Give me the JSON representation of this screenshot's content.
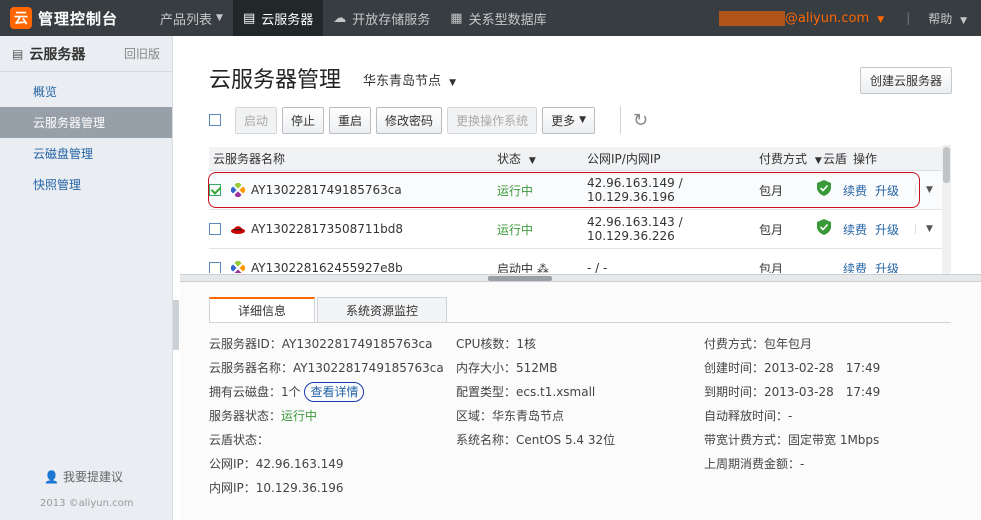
{
  "topbar": {
    "logo_glyph": "云",
    "brand": "管理控制台",
    "nav": [
      {
        "label": "产品列表",
        "icon": "",
        "caret": true,
        "active": false
      },
      {
        "label": "云服务器",
        "icon": "server-icon",
        "caret": false,
        "active": true
      },
      {
        "label": "开放存储服务",
        "icon": "cloud-icon",
        "caret": false,
        "active": false
      },
      {
        "label": "关系型数据库",
        "icon": "database-icon",
        "caret": false,
        "active": false
      }
    ],
    "user_blur": "■■■■■",
    "user_suffix": "@aliyun.com",
    "help": "帮助"
  },
  "sidebar": {
    "title": "云服务器",
    "old_version": "回旧版",
    "items": [
      {
        "label": "概览"
      },
      {
        "label": "云服务器管理"
      },
      {
        "label": "云磁盘管理"
      },
      {
        "label": "快照管理"
      }
    ],
    "suggest": "我要提建议",
    "copyright": "2013 ©aliyun.com"
  },
  "main": {
    "title": "云服务器管理",
    "region": "华东青岛节点",
    "create_button": "创建云服务器",
    "toolbar": {
      "start": "启动",
      "stop": "停止",
      "restart": "重启",
      "change_password": "修改密码",
      "change_os": "更换操作系统",
      "more": "更多"
    },
    "table": {
      "headers": {
        "name": "云服务器名称",
        "status": "状态",
        "ip": "公网IP/内网IP",
        "pay": "付费方式",
        "shield": "云盾",
        "ops": "操作"
      },
      "rows": [
        {
          "name": "AY1302281749185763ca",
          "os": "centos",
          "status": "运行中",
          "ip": "42.96.163.149 / 10.129.36.196",
          "pay": "包月",
          "renew": "续费",
          "upgrade": "升级",
          "checked": true
        },
        {
          "name": "AY130228173508711bd8",
          "os": "redhat",
          "status": "运行中",
          "ip": "42.96.163.143 / 10.129.36.226",
          "pay": "包月",
          "renew": "续费",
          "upgrade": "升级",
          "checked": false
        },
        {
          "name": "AY130228162455927e8b",
          "os": "centos",
          "status": "启动中",
          "ip": "- / -",
          "pay": "包月",
          "renew": "续费",
          "upgrade": "升级",
          "checked": false
        }
      ]
    }
  },
  "details": {
    "tabs": [
      "详细信息",
      "系统资源监控"
    ],
    "col1": {
      "server_id": "云服务器ID：AY1302281749185763ca",
      "server_name": "云服务器名称：AY1302281749185763ca",
      "disks_prefix": "拥有云磁盘：1个",
      "disks_link": "查看详情",
      "status_prefix": "服务器状态：",
      "status_value": "运行中",
      "shield": "云盾状态：",
      "public_ip": "公网IP：42.96.163.149",
      "private_ip": "内网IP：10.129.36.196"
    },
    "col2": {
      "cpu": "CPU核数：1核",
      "memory": "内存大小：512MB",
      "type": "配置类型：ecs.t1.xsmall",
      "region": "区域：华东青岛节点",
      "os": "系统名称：CentOS 5.4 32位"
    },
    "col3": {
      "pay": "付费方式：包年包月",
      "created": "创建时间：2013-02-28　17:49",
      "expires": "到期时间：2013-03-28　17:49",
      "auto_release": "自动释放时间：-",
      "bandwidth": "带宽计费方式：固定带宽 1Mbps",
      "last_week": "上周期消费金额：-"
    }
  },
  "colors": {
    "topbar": "#373d41",
    "accent": "#ff6600",
    "link": "#2464a6",
    "running": "#3a9a3a",
    "highlight": "#c8101e"
  }
}
